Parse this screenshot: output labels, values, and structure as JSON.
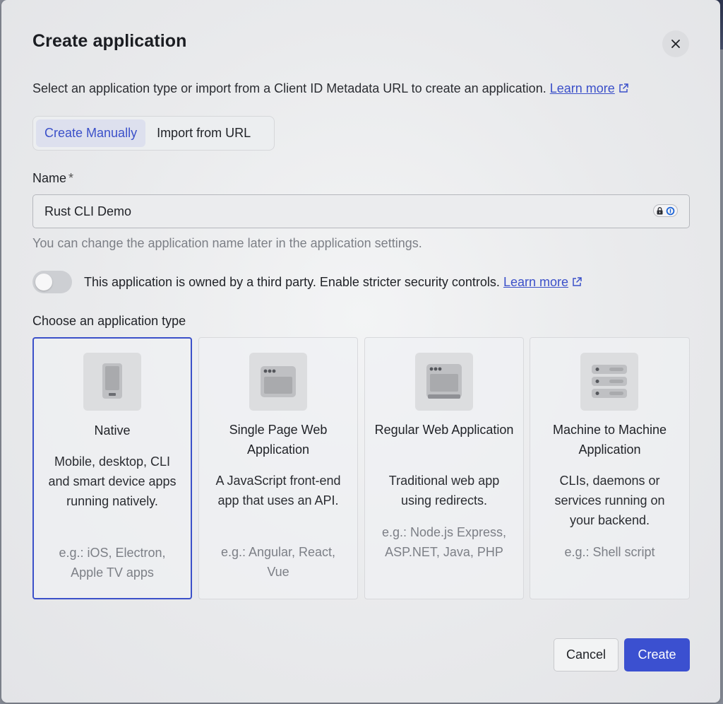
{
  "dialog": {
    "title": "Create application",
    "subtitle": "Select an application type or import from a Client ID Metadata URL to create an application.",
    "subtitle_link": "Learn more",
    "close_icon": "close-icon"
  },
  "tabs": [
    {
      "label": "Create Manually",
      "active": true
    },
    {
      "label": "Import from URL",
      "active": false
    }
  ],
  "name_field": {
    "label": "Name",
    "required_mark": "*",
    "value": "Rust CLI Demo",
    "hint": "You can change the application name later in the application settings."
  },
  "third_party": {
    "enabled": false,
    "text": "This application is owned by a third party. Enable stricter security controls.",
    "link": "Learn more"
  },
  "app_types": {
    "label": "Choose an application type",
    "cards": [
      {
        "icon": "mobile-device-icon",
        "title": "Native",
        "description": "Mobile, desktop, CLI and smart device apps running natively.",
        "example": "e.g.: iOS, Electron, Apple TV apps",
        "selected": true
      },
      {
        "icon": "browser-window-icon",
        "title": "Single Page Web Application",
        "description": "A JavaScript front-end app that uses an API.",
        "example": "e.g.: Angular, React, Vue",
        "selected": false
      },
      {
        "icon": "web-page-icon",
        "title": "Regular Web Application",
        "description": "Traditional web app using redirects.",
        "example": "e.g.: Node.js Express, ASP.NET, Java, PHP",
        "selected": false
      },
      {
        "icon": "server-stack-icon",
        "title": "Machine to Machine Application",
        "description": "CLIs, daemons or services running on your backend.",
        "example": "e.g.: Shell script",
        "selected": false
      }
    ]
  },
  "footer": {
    "cancel_label": "Cancel",
    "create_label": "Create"
  },
  "colors": {
    "accent": "#3b50d0",
    "link": "#3b50c9"
  }
}
